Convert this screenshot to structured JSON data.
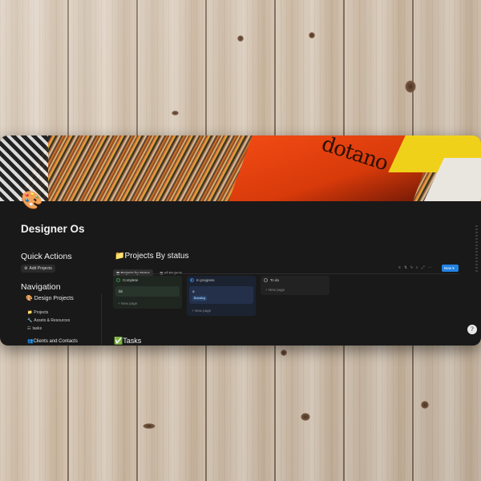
{
  "page": {
    "title": "Designer Os",
    "icon": "🎨"
  },
  "quick_actions": {
    "heading": "Quick Actions",
    "add_projects_label": "Add Projects",
    "add_projects_icon": "gear-icon"
  },
  "navigation": {
    "heading": "Navigation",
    "design_projects": {
      "icon": "🎨",
      "label": "Design Projects"
    },
    "items": [
      {
        "icon": "📁",
        "label": "Projects"
      },
      {
        "icon": "🔧",
        "label": "Assets & Resources"
      },
      {
        "icon": "☷",
        "label": "tasks"
      }
    ],
    "clients": {
      "icon": "👥",
      "label": "Clients and Contacts"
    }
  },
  "board": {
    "icon": "📁",
    "title": "Projects By status",
    "tabs": [
      {
        "icon": "▦",
        "label": "Projects by Status"
      },
      {
        "icon": "▦",
        "label": "All Projects"
      }
    ],
    "toolbar_icons": [
      "filter-icon",
      "sort-icon",
      "lightning-icon",
      "search-icon",
      "expand-icon",
      "more-icon"
    ],
    "new_label": "New",
    "columns": [
      {
        "status": "Complete",
        "color": "#3e8a52",
        "cards": [
          {
            "title": "bb",
            "tag": ""
          }
        ],
        "new_page_label": "+ New page"
      },
      {
        "status": "In progress",
        "color": "#2f77c7",
        "cards": [
          {
            "title": "a",
            "tag": "Branding"
          }
        ],
        "new_page_label": "+ New page"
      },
      {
        "status": "To do",
        "color": "#8a8a8a",
        "cards": [],
        "new_page_label": "+ New page"
      }
    ]
  },
  "tasks": {
    "icon": "✅",
    "heading": "Tasks"
  },
  "help_icon": "help-icon"
}
